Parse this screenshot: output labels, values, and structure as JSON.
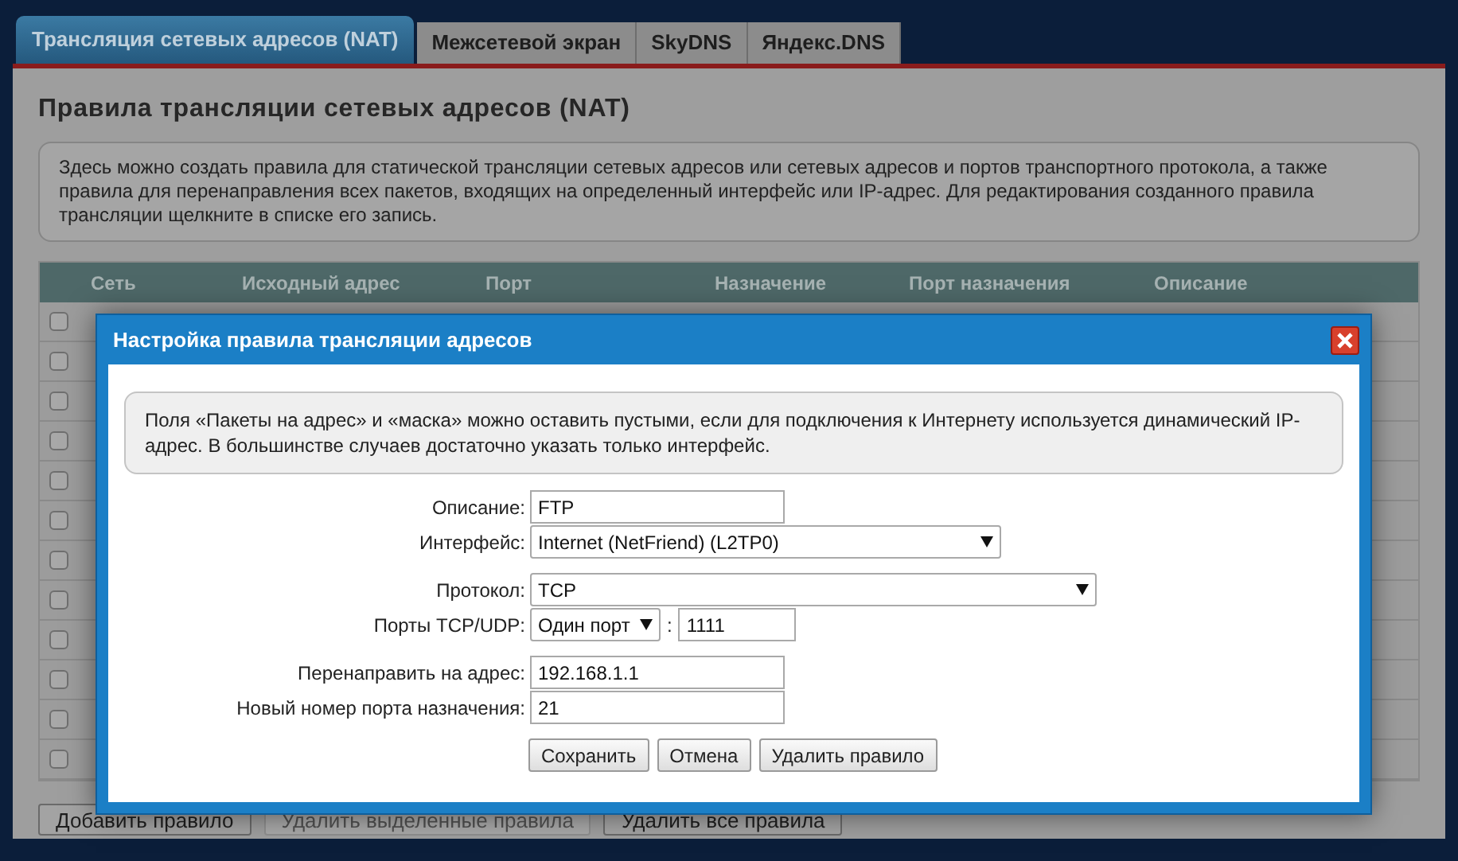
{
  "tabs": [
    {
      "label": "Трансляция сетевых адресов (NAT)",
      "selected": true
    },
    {
      "label": "Межсетевой экран",
      "selected": false
    },
    {
      "label": "SkyDNS",
      "selected": false
    },
    {
      "label": "Яндекс.DNS",
      "selected": false
    }
  ],
  "page_title": "Правила трансляции сетевых адресов (NAT)",
  "info_text": "Здесь можно создать правила для статической трансляции сетевых адресов или сетевых адресов и портов транспортного протокола, а также правила для перенаправления всех пакетов, входящих на определенный интерфейс или IP-адрес. Для редактирования созданного правила трансляции щелкните в списке его запись.",
  "table": {
    "columns": [
      "Сеть",
      "Исходный адрес",
      "Порт",
      "Назначение",
      "Порт назначения",
      "Описание"
    ],
    "rows": [
      {
        "checked": false
      },
      {
        "checked": false
      },
      {
        "checked": false
      },
      {
        "checked": false
      },
      {
        "checked": false
      },
      {
        "checked": false
      },
      {
        "checked": false
      },
      {
        "checked": false
      },
      {
        "checked": false
      },
      {
        "checked": false
      },
      {
        "checked": false
      },
      {
        "checked": false
      }
    ]
  },
  "bottom_buttons": [
    {
      "label": "Добавить правило",
      "disabled": false
    },
    {
      "label": "Удалить выделенные правила",
      "disabled": true
    },
    {
      "label": "Удалить все правила",
      "disabled": false
    }
  ],
  "dialog": {
    "title": "Настройка правила трансляции адресов",
    "hint": "Поля «Пакеты на адрес» и «маска» можно оставить пустыми, если для подключения к Интернету используется динамический IP-адрес. В большинстве случаев достаточно указать только интерфейс.",
    "groups": [
      [
        {
          "kind": "text",
          "label": "Описание:",
          "value": "FTP"
        },
        {
          "kind": "select",
          "label": "Интерфейс:",
          "value": "Internet (NetFriend) (L2TP0)"
        }
      ],
      [
        {
          "kind": "select",
          "label": "Протокол:",
          "value": "TCP"
        },
        {
          "kind": "ports",
          "label": "Порты TCP/UDP:",
          "value": "Один порт",
          "separator": ":",
          "port": "1111"
        }
      ],
      [
        {
          "kind": "text",
          "label": "Перенаправить на адрес:",
          "value": "192.168.1.1"
        },
        {
          "kind": "text",
          "label": "Новый номер порта назначения:",
          "value": "21"
        }
      ]
    ],
    "buttons": [
      "Сохранить",
      "Отмена",
      "Удалить правило"
    ]
  }
}
